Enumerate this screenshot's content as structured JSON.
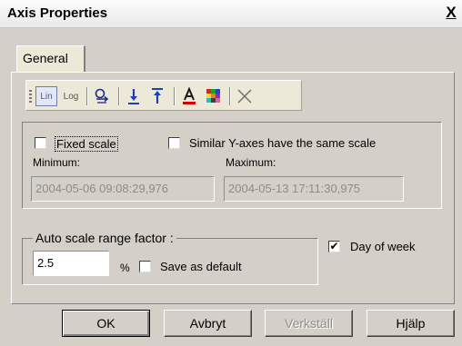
{
  "window": {
    "title": "Axis Properties",
    "close_label": "X"
  },
  "tabs": [
    {
      "label": "General",
      "active": true
    }
  ],
  "toolbar": {
    "lin_label": "Lin",
    "log_label": "Log",
    "icons": [
      "auto-scale-icon",
      "arrow-down-icon",
      "arrow-up-icon",
      "font-color-icon",
      "color-palette-icon",
      "delete-icon"
    ]
  },
  "scale_group": {
    "fixed_scale_label": "Fixed scale",
    "fixed_scale_checked": false,
    "similar_axes_label": "Similar Y-axes have the same scale",
    "similar_axes_checked": false,
    "minimum_label": "Minimum:",
    "minimum_value": "2004-05-06 09:08:29,976",
    "maximum_label": "Maximum:",
    "maximum_value": "2004-05-13 17:11:30,975"
  },
  "auto_scale": {
    "title": "Auto scale range factor :",
    "value": "2.5",
    "unit": "%",
    "save_default_label": "Save as default",
    "save_default_checked": false
  },
  "day_of_week": {
    "label": "Day of week",
    "checked": true,
    "check_mark": "✔"
  },
  "buttons": {
    "ok": "OK",
    "cancel": "Avbryt",
    "apply": "Verkställ",
    "help": "Hjälp"
  },
  "colors": {
    "text_disabled": "#8c8c8c",
    "toolbar_accent": "#4a5c9a",
    "font_color_red": "#d40000"
  }
}
